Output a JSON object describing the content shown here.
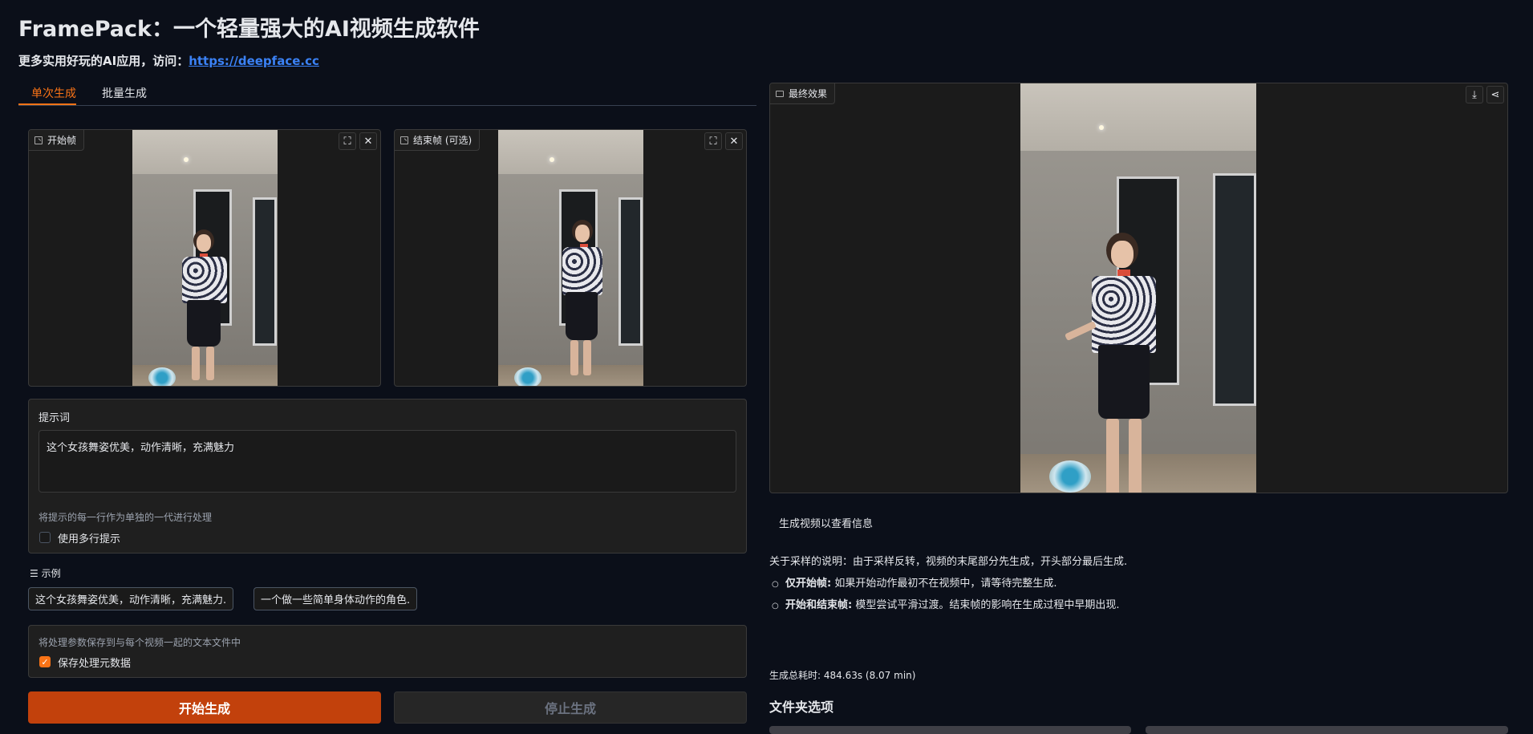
{
  "header": {
    "title": "FramePack：一个轻量强大的AI视频生成软件",
    "subtitle_prefix": "更多实用好玩的AI应用，访问：",
    "subtitle_link": "https://deepface.cc"
  },
  "tabs": [
    {
      "label": "单次生成",
      "active": true
    },
    {
      "label": "批量生成",
      "active": false
    }
  ],
  "start_frame": {
    "label": "开始帧"
  },
  "end_frame": {
    "label": "结束帧 (可选)"
  },
  "prompt": {
    "label": "提示词",
    "value": "这个女孩舞姿优美，动作清晰，充满魅力",
    "multiline_hint": "将提示的每一行作为单独的一代进行处理",
    "multiline_label": "使用多行提示",
    "multiline_checked": false
  },
  "examples": {
    "label": "示例",
    "items": [
      "这个女孩舞姿优美，动作清晰，充满魅力.",
      "一个做一些简单身体动作的角色."
    ]
  },
  "metadata": {
    "hint": "将处理参数保存到与每个视频一起的文本文件中",
    "label": "保存处理元数据",
    "checked": true
  },
  "buttons": {
    "start": "开始生成",
    "stop": "停止生成"
  },
  "result": {
    "label": "最终效果"
  },
  "status_text": "生成视频以查看信息",
  "sampling_note": {
    "intro": "关于采样的说明：由于采样反转，视频的末尾部分先生成，开头部分最后生成.",
    "items": [
      {
        "bold": "仅开始帧:",
        "text": " 如果开始动作最初不在视频中，请等待完整生成."
      },
      {
        "bold": "开始和结束帧:",
        "text": " 模型尝试平滑过渡。结束帧的影响在生成过程中早期出现."
      }
    ]
  },
  "total_time": "生成总耗时: 484.63s (8.07 min)",
  "folder_options": {
    "title": "文件夹选项"
  },
  "icons": {
    "image": "image-icon",
    "fullscreen": "fullscreen-icon",
    "close": "close-icon",
    "video": "video-icon",
    "download": "download-icon",
    "share": "share-icon",
    "list": "list-icon",
    "check": "check-icon"
  },
  "colors": {
    "accent": "#f97316",
    "primary_button": "#c2410c",
    "link": "#3b82f6",
    "background": "#0b0f19"
  }
}
